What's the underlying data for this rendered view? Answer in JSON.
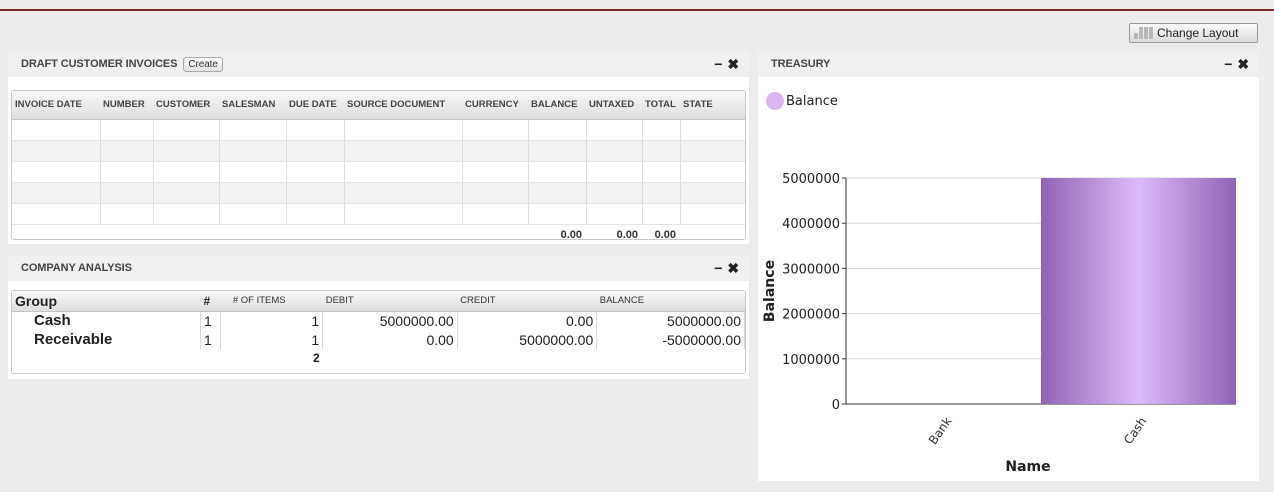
{
  "toolbar": {
    "change_layout_label": "Change Layout"
  },
  "invoices": {
    "title": "DRAFT CUSTOMER INVOICES",
    "create_label": "Create",
    "minimize_icon": "minus-icon",
    "close_icon": "close-icon",
    "columns": [
      "INVOICE DATE",
      "NUMBER",
      "CUSTOMER",
      "SALESMAN",
      "DUE DATE",
      "SOURCE DOCUMENT",
      "CURRENCY",
      "BALANCE",
      "UNTAXED",
      "TOTAL",
      "STATE"
    ],
    "totals": {
      "balance": "0.00",
      "untaxed": "0.00",
      "total": "0.00"
    }
  },
  "analysis": {
    "title": "COMPANY ANALYSIS",
    "columns": {
      "group": "Group",
      "count": "#",
      "items": "# OF ITEMS",
      "debit": "DEBIT",
      "credit": "CREDIT",
      "balance": "BALANCE"
    },
    "rows": [
      {
        "group": "Cash",
        "count": "1",
        "items": "1",
        "debit": "5000000.00",
        "credit": "0.00",
        "balance": "5000000.00"
      },
      {
        "group": "Receivable",
        "count": "1",
        "items": "1",
        "debit": "0.00",
        "credit": "5000000.00",
        "balance": "-5000000.00"
      }
    ],
    "footer_items": "2"
  },
  "treasury": {
    "title": "TREASURY",
    "minimize_icon": "minus-icon",
    "close_icon": "close-icon"
  },
  "chart_data": {
    "type": "bar",
    "categories": [
      "Bank",
      "Cash"
    ],
    "series": [
      {
        "name": "Balance",
        "values": [
          0,
          5000000
        ],
        "color": "#d7b6f2"
      }
    ],
    "xlabel": "Name",
    "ylabel": "Balance",
    "ylim": [
      0,
      5000000
    ],
    "yticks": [
      0,
      1000000,
      2000000,
      3000000,
      4000000,
      5000000
    ],
    "grid": true,
    "legend": "top-left"
  }
}
